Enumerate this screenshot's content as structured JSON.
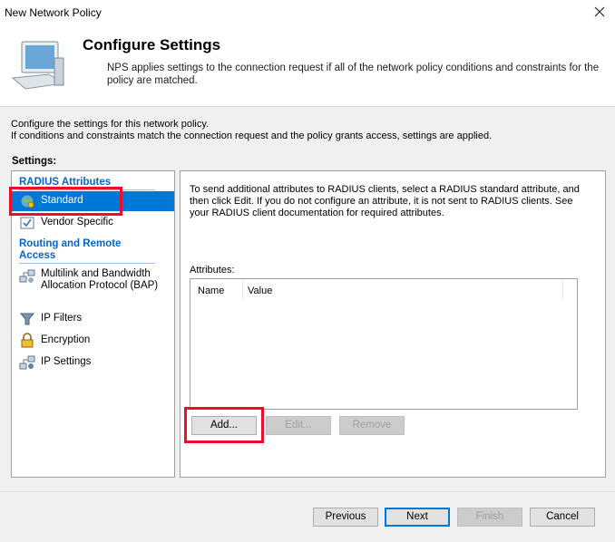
{
  "window": {
    "title": "New Network Policy"
  },
  "header": {
    "heading": "Configure Settings",
    "description": "NPS applies settings to the connection request if all of the network policy conditions and constraints for the policy are matched."
  },
  "intro": {
    "line1": "Configure the settings for this network policy.",
    "line2": "If conditions and constraints match the connection request and the policy grants access, settings are applied."
  },
  "settings_label": "Settings:",
  "tree": {
    "radius_group": "RADIUS Attributes",
    "standard": "Standard",
    "vendor_specific": "Vendor Specific",
    "routing_group": "Routing and Remote Access",
    "multilink": "Multilink and Bandwidth Allocation Protocol (BAP)",
    "ip_filters": "IP Filters",
    "encryption": "Encryption",
    "ip_settings": "IP Settings"
  },
  "panel": {
    "help": "To send additional attributes to RADIUS clients, select a RADIUS standard attribute, and then click Edit. If you do not configure an attribute, it is not sent to RADIUS clients. See your RADIUS client documentation for required attributes.",
    "attributes_label": "Attributes:",
    "columns": [
      "Name",
      "Value"
    ],
    "add": "Add...",
    "edit": "Edit...",
    "remove": "Remove"
  },
  "footer": {
    "previous": "Previous",
    "next": "Next",
    "finish": "Finish",
    "cancel": "Cancel"
  },
  "colors": {
    "accent": "#0078d7",
    "highlight": "#e8102a",
    "group_text": "#0066cc"
  }
}
